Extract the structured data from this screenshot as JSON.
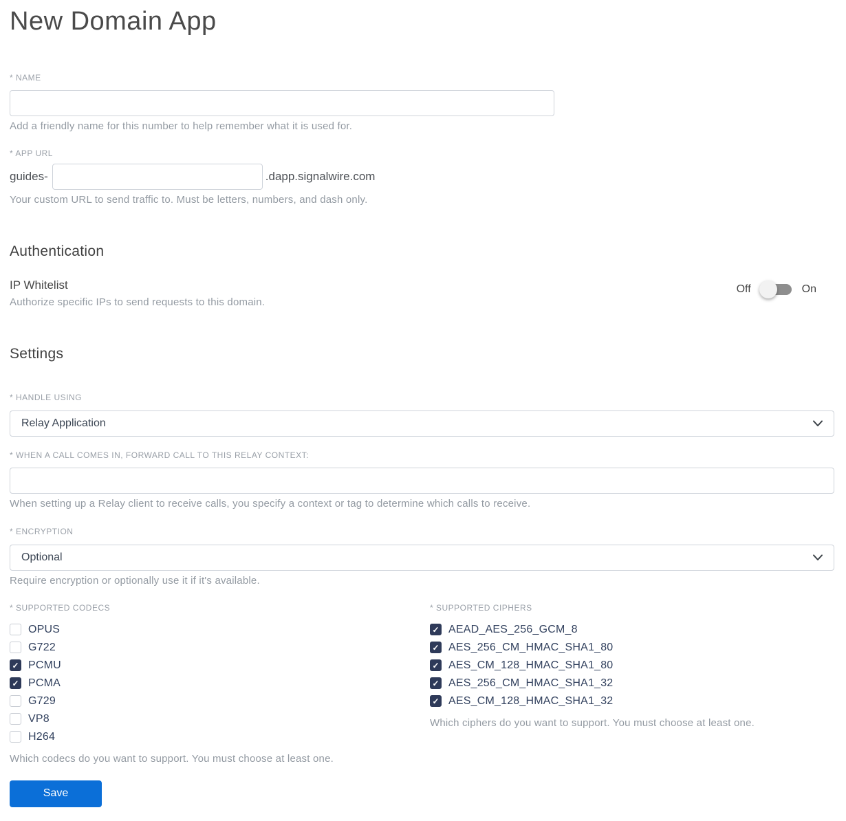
{
  "page": {
    "title": "New Domain App"
  },
  "name_field": {
    "label": "* NAME",
    "value": "",
    "helper": "Add a friendly name for this number to help remember what it is used for."
  },
  "app_url_field": {
    "label": "* APP URL",
    "prefix": "guides-",
    "value": "",
    "suffix": ".dapp.signalwire.com",
    "helper": "Your custom URL to send traffic to. Must be letters, numbers, and dash only."
  },
  "authentication": {
    "heading": "Authentication",
    "ip_whitelist": {
      "label": "IP Whitelist",
      "helper": "Authorize specific IPs to send requests to this domain.",
      "off_label": "Off",
      "on_label": "On",
      "state": "off"
    }
  },
  "settings": {
    "heading": "Settings",
    "handle_using": {
      "label": "* HANDLE USING",
      "selected": "Relay Application"
    },
    "relay_context": {
      "label": "* WHEN A CALL COMES IN, FORWARD CALL TO THIS RELAY CONTEXT:",
      "value": "",
      "helper": "When setting up a Relay client to receive calls, you specify a context or tag to determine which calls to receive."
    },
    "encryption": {
      "label": "* ENCRYPTION",
      "selected": "Optional",
      "helper": "Require encryption or optionally use it if it's available."
    },
    "codecs": {
      "label": "* SUPPORTED CODECS",
      "options": [
        {
          "label": "OPUS",
          "checked": false
        },
        {
          "label": "G722",
          "checked": false
        },
        {
          "label": "PCMU",
          "checked": true
        },
        {
          "label": "PCMA",
          "checked": true
        },
        {
          "label": "G729",
          "checked": false
        },
        {
          "label": "VP8",
          "checked": false
        },
        {
          "label": "H264",
          "checked": false
        }
      ],
      "helper": "Which codecs do you want to support. You must choose at least one."
    },
    "ciphers": {
      "label": "* SUPPORTED CIPHERS",
      "options": [
        {
          "label": "AEAD_AES_256_GCM_8",
          "checked": true
        },
        {
          "label": "AES_256_CM_HMAC_SHA1_80",
          "checked": true
        },
        {
          "label": "AES_CM_128_HMAC_SHA1_80",
          "checked": true
        },
        {
          "label": "AES_256_CM_HMAC_SHA1_32",
          "checked": true
        },
        {
          "label": "AES_CM_128_HMAC_SHA1_32",
          "checked": true
        }
      ],
      "helper": "Which ciphers do you want to support. You must choose at least one."
    }
  },
  "actions": {
    "save_label": "Save"
  },
  "colors": {
    "primary_button": "#0b6fd8",
    "checkbox_checked": "#2e3a59",
    "toggle_track": "#8e8e8e"
  }
}
